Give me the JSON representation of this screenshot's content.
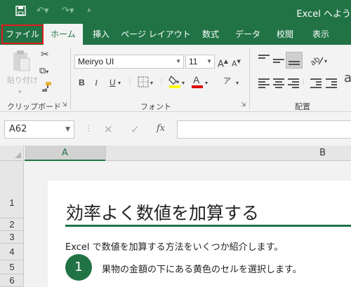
{
  "window": {
    "title": "Excel へよう"
  },
  "qat": {
    "save_icon": "save-icon",
    "undo_icon": "undo-icon",
    "redo_icon": "redo-icon",
    "customize_icon": "customize-icon"
  },
  "tabs": [
    {
      "label": "ファイル",
      "highlighted": true
    },
    {
      "label": "ホーム",
      "active": true
    },
    {
      "label": "挿入"
    },
    {
      "label": "ページ レイアウト"
    },
    {
      "label": "数式"
    },
    {
      "label": "データ"
    },
    {
      "label": "校閲"
    },
    {
      "label": "表示"
    }
  ],
  "ribbon": {
    "clipboard": {
      "paste_label": "貼り付け",
      "group_label": "クリップボード"
    },
    "font": {
      "font_name": "Meiryo UI",
      "font_size": "11",
      "group_label": "フォント",
      "bold": "B",
      "italic": "I",
      "underline": "U",
      "grow": "A",
      "shrink": "A"
    },
    "alignment": {
      "group_label": "配置"
    }
  },
  "formula_bar": {
    "name_box": "A62",
    "fx_label": "fx",
    "cancel": "✕",
    "enter": "✓",
    "dots": "⋮",
    "formula": ""
  },
  "columns": [
    {
      "label": "A",
      "selected": true
    },
    {
      "label": "B"
    }
  ],
  "rows": [
    "1",
    "2",
    "3",
    "4",
    "5",
    "6"
  ],
  "content": {
    "heading": "効率よく数値を加算する",
    "intro": "Excel で数値を加算する方法をいくつか紹介します。",
    "step_number": "1",
    "step_text": "果物の金額の下にある黄色のセルを選択します。"
  },
  "colors": {
    "accent": "#217346",
    "highlight_outline": "#e01c1c"
  }
}
